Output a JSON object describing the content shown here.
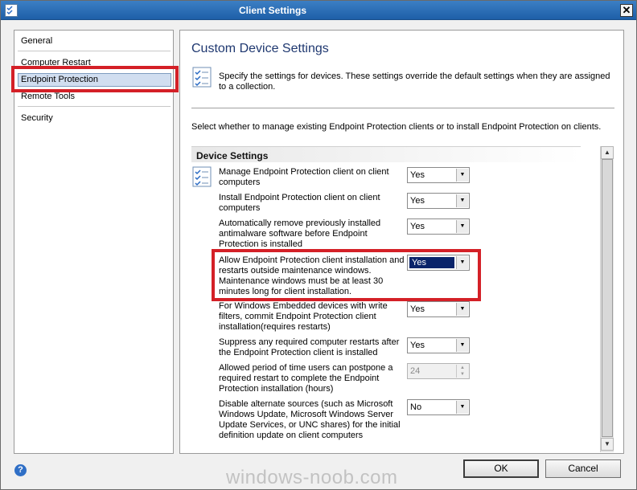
{
  "window": {
    "title": "Client Settings",
    "close_glyph": "✕",
    "app_icon": "checklist-icon"
  },
  "nav": {
    "items": [
      {
        "label": "General"
      },
      {
        "label": "Computer Restart"
      },
      {
        "label": "Endpoint Protection",
        "selected": true
      },
      {
        "label": "Remote Tools"
      },
      {
        "label": "Security"
      }
    ]
  },
  "main": {
    "title": "Custom Device Settings",
    "intro": "Specify the settings for devices. These settings override the default settings when they are assigned to a collection.",
    "instruction": "Select whether to manage existing Endpoint Protection clients or to install Endpoint Protection on clients.",
    "group_header": "Device Settings",
    "settings": [
      {
        "label": "Manage Endpoint Protection client on client computers",
        "value": "Yes"
      },
      {
        "label": "Install Endpoint Protection client on client computers",
        "value": "Yes"
      },
      {
        "label": "Automatically remove previously installed antimalware software before Endpoint Protection is installed",
        "value": "Yes"
      },
      {
        "label": "Allow Endpoint Protection client installation and restarts outside maintenance windows. Maintenance windows must be at least 30 minutes long for client installation.",
        "value": "Yes"
      },
      {
        "label": "For Windows Embedded devices with write filters, commit Endpoint Protection client installation(requires restarts)",
        "value": "Yes"
      },
      {
        "label": "Suppress any required computer restarts after the Endpoint Protection client is installed",
        "value": "Yes"
      },
      {
        "label": "Allowed period of time users can postpone a required restart to complete the Endpoint Protection installation (hours)",
        "value": "24"
      },
      {
        "label": "Disable alternate sources (such as Microsoft Windows Update, Microsoft Windows Server Update Services, or UNC shares) for the initial definition update on client computers",
        "value": "No"
      }
    ]
  },
  "footer": {
    "ok": "OK",
    "cancel": "Cancel",
    "help_glyph": "?"
  },
  "watermark": "windows-noob.com",
  "colors": {
    "highlight_red": "#d42027",
    "title_blue": "#1f3870",
    "selection": "#0a246a"
  }
}
